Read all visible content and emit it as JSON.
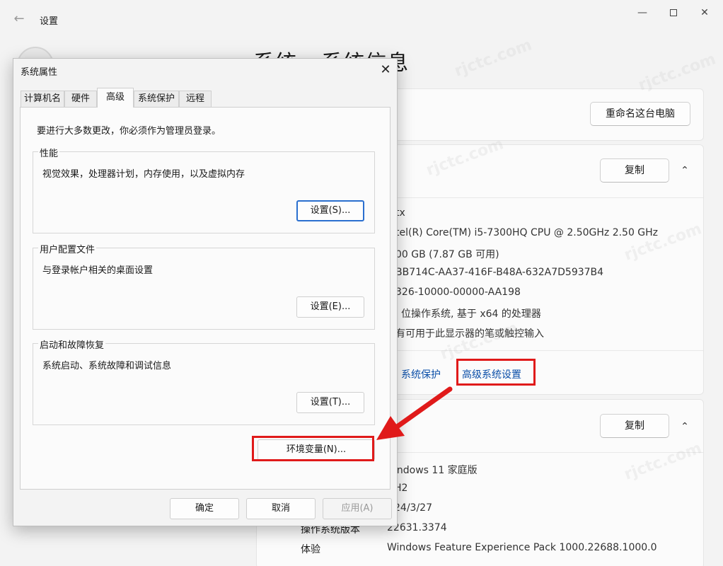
{
  "settings": {
    "app_title": "设置",
    "page_title": "系统 › 系统信息",
    "rename_button": "重命名这台电脑",
    "copy_button": "复制",
    "device_specs": [
      "tx",
      "tel(R) Core(TM) i5-7300HQ CPU @ 2.50GHz   2.50 GHz",
      "00 GB (7.87 GB 可用)",
      "BB714C-AA37-416F-B48A-632A7D5937B4",
      "326-10000-00000-AA198",
      "位操作系统, 基于 x64 的处理器",
      "有可用于此显示器的笔或触控输入"
    ],
    "links": {
      "system_protection": "系统保护",
      "advanced_settings": "高级系统设置"
    },
    "windows_specs": {
      "values": [
        "indows 11 家庭版",
        "H2",
        "24/3/27"
      ],
      "rows": [
        {
          "key": "操作系统版本",
          "value": "22631.3374"
        },
        {
          "key": "体验",
          "value": "Windows Feature Experience Pack 1000.22688.1000.0"
        }
      ]
    },
    "watermark": "rjctc.com"
  },
  "dialog": {
    "title": "系统属性",
    "tabs": [
      "计算机名",
      "硬件",
      "高级",
      "系统保护",
      "远程"
    ],
    "active_tab": "高级",
    "admin_note": "要进行大多数更改，你必须作为管理员登录。",
    "groups": [
      {
        "title": "性能",
        "desc": "视觉效果，处理器计划，内存使用，以及虚拟内存",
        "button": "设置(S)..."
      },
      {
        "title": "用户配置文件",
        "desc": "与登录帐户相关的桌面设置",
        "button": "设置(E)..."
      },
      {
        "title": "启动和故障恢复",
        "desc": "系统启动、系统故障和调试信息",
        "button": "设置(T)..."
      }
    ],
    "env_button": "环境变量(N)...",
    "ok_button": "确定",
    "cancel_button": "取消",
    "apply_button": "应用(A)"
  },
  "colors": {
    "highlight": "#e01a1a",
    "link": "#0a4ea8",
    "primary_border": "#2a6fcf"
  },
  "icons": [
    "back-arrow-icon",
    "minimize-icon",
    "maximize-icon",
    "close-icon",
    "chevron-up-icon"
  ]
}
